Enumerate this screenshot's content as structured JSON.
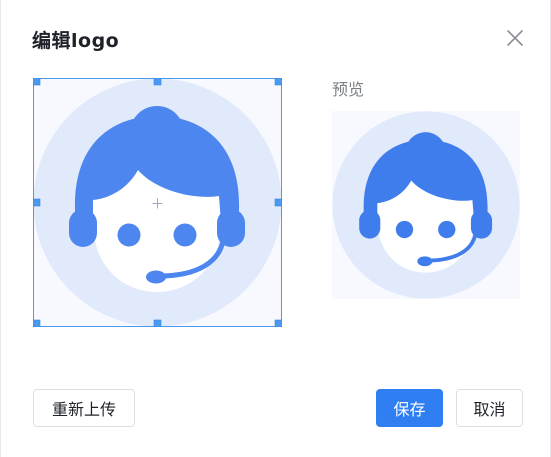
{
  "dialog": {
    "title": "编辑logo",
    "close_icon": "close-icon"
  },
  "editor": {
    "avatar_icon": "customer-service-avatar-icon",
    "crosshair_icon": "crosshair-icon"
  },
  "preview": {
    "label": "预览"
  },
  "footer": {
    "reupload_label": "重新上传",
    "save_label": "保存",
    "cancel_label": "取消"
  },
  "colors": {
    "primary": "#2f7ff2",
    "avatar_fill": "#4d86ee",
    "avatar_bg": "#e1eafb",
    "selection": "#4a9af0"
  }
}
